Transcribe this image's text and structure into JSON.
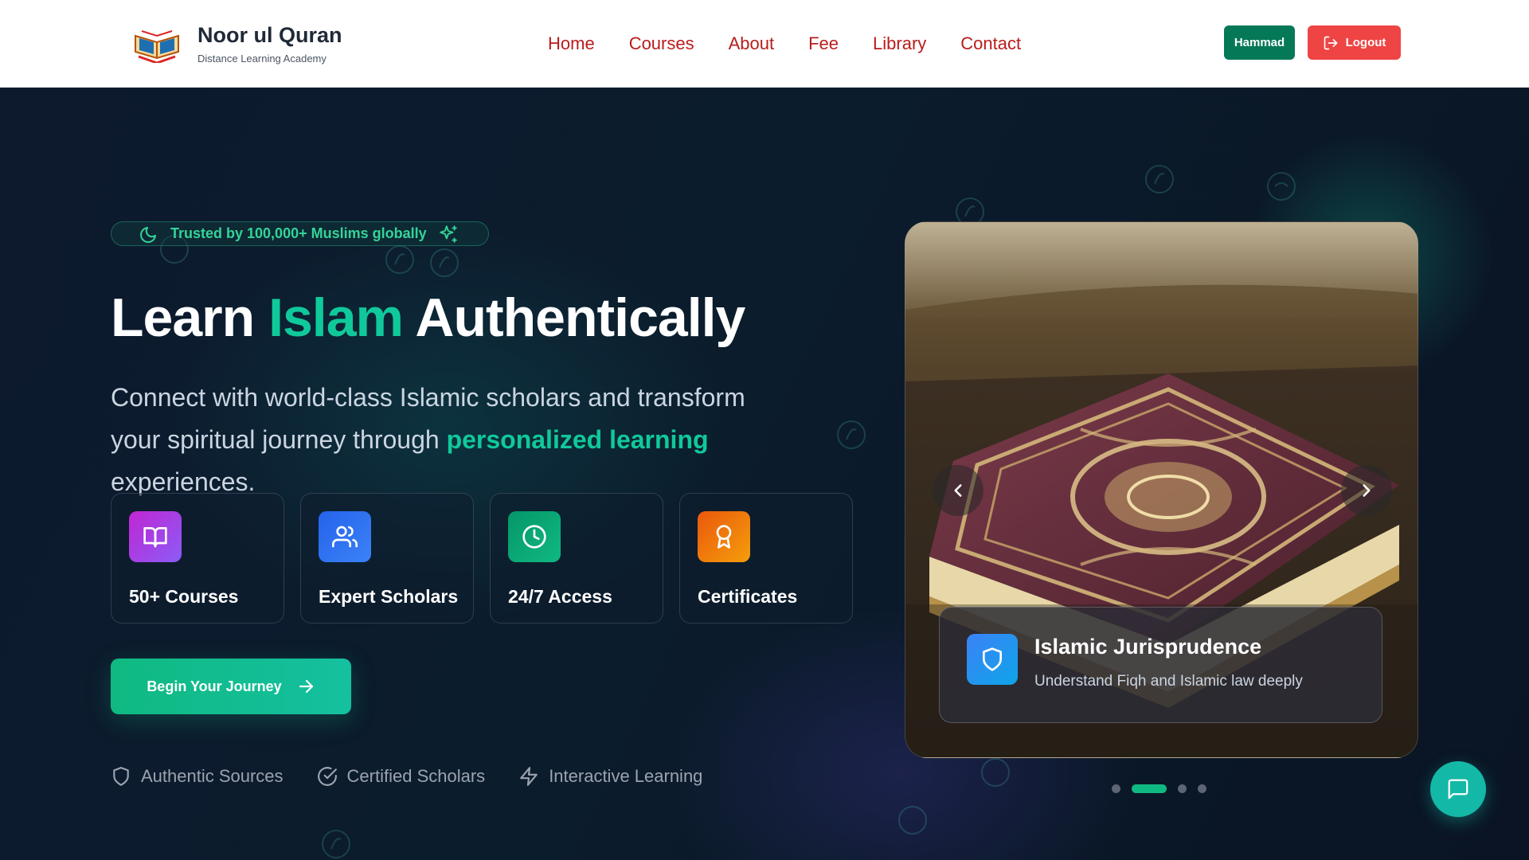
{
  "brand": {
    "title": "Noor ul Quran",
    "subtitle": "Distance Learning Academy",
    "logo_icon": "quran-book-logo"
  },
  "nav": {
    "items": [
      "Home",
      "Courses",
      "About",
      "Fee",
      "Library",
      "Contact"
    ]
  },
  "account": {
    "user_label": "Hammad",
    "logout_label": "Logout"
  },
  "hero": {
    "trust_text": "Trusted by 100,000+ Muslims globally",
    "headline_part1": "Learn",
    "headline_accent": "Islam",
    "headline_part2": "Authentically",
    "lead_part1": "Connect with world-class Islamic scholars and transform your spiritual journey through",
    "lead_accent": "personalized learning",
    "lead_part2": "experiences.",
    "features": [
      {
        "label": "50+ Courses",
        "icon": "book-open-icon",
        "color": "#a855f7"
      },
      {
        "label": "Expert Scholars",
        "icon": "users-icon",
        "color": "#3b82f6"
      },
      {
        "label": "24/7 Access",
        "icon": "clock-icon",
        "color": "#10b981"
      },
      {
        "label": "Certificates",
        "icon": "award-icon",
        "color": "#f59e0b"
      }
    ],
    "cta_label": "Begin Your Journey",
    "badges": [
      "Authentic Sources",
      "Certified Scholars",
      "Interactive Learning"
    ]
  },
  "carousel": {
    "slide_title": "Islamic Jurisprudence",
    "slide_subtitle": "Understand Fiqh and Islamic law deeply",
    "slide_count": 4,
    "active_index": 1
  },
  "colors": {
    "accent": "#10c99a",
    "nav_text": "#b91c1c",
    "user_button": "#047857",
    "logout_button": "#ef4444",
    "chat_button": "#14b8a6"
  }
}
